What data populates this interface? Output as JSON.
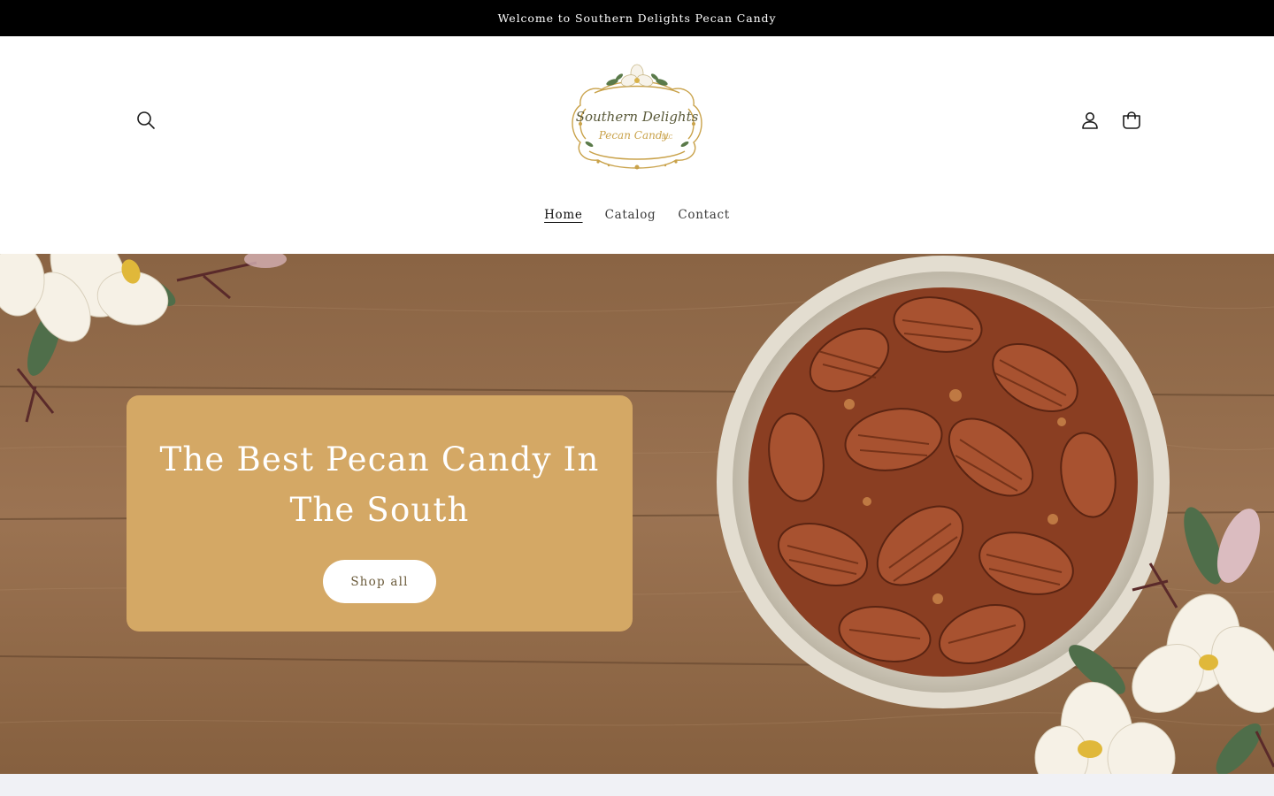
{
  "announcement": {
    "text": "Welcome to Southern Delights Pecan Candy"
  },
  "header": {
    "logo": {
      "line1": "Southern Delights",
      "line2": "Pecan Candy",
      "suffix": "LLC"
    },
    "icons": {
      "search": "search-icon",
      "account": "account-icon",
      "cart": "cart-icon"
    }
  },
  "nav": {
    "items": [
      {
        "label": "Home",
        "active": true
      },
      {
        "label": "Catalog",
        "active": false
      },
      {
        "label": "Contact",
        "active": false
      }
    ]
  },
  "hero": {
    "title": "The Best Pecan Candy In The South",
    "button_label": "Shop all",
    "box_color": "#d4a865"
  },
  "colors": {
    "announcement_bg": "#000000",
    "accent": "#d4a865",
    "page_bg": "#ffffff"
  }
}
